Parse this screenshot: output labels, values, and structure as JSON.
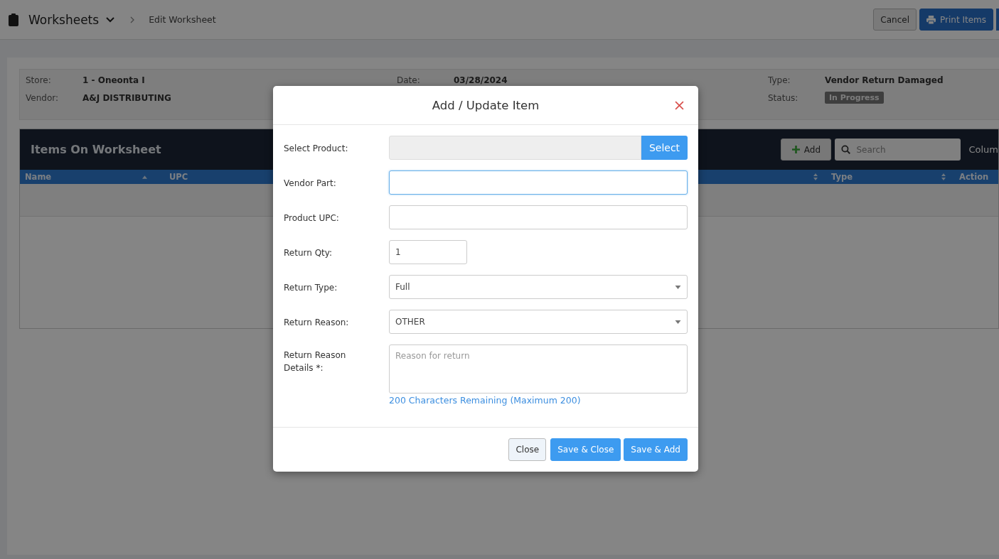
{
  "breadcrumb": {
    "title": "Worksheets",
    "current": "Edit Worksheet"
  },
  "header_buttons": [
    {
      "label": "Cancel",
      "kind": "secondary"
    },
    {
      "label": "Print Items",
      "kind": "primary"
    }
  ],
  "info_left": [
    {
      "label": "Store:",
      "value": "1 - Oneonta I"
    },
    {
      "label": "Vendor:",
      "value": "A&J DISTRIBUTING"
    }
  ],
  "info_middle": [
    {
      "label": "Date:",
      "value": "03/28/2024"
    }
  ],
  "info_right": [
    {
      "label": "Type:",
      "value": "Vendor Return Damaged",
      "kind": "text"
    },
    {
      "label": "Status:",
      "value": "In Progress",
      "kind": "badge"
    }
  ],
  "items_panel": {
    "title": "Items On Worksheet",
    "add_label": "Add",
    "search_placeholder": "Search",
    "columns_label": "Colum",
    "columns": [
      {
        "label": "Name",
        "sorted": true
      },
      {
        "label": "UPC",
        "sorted": false
      },
      {
        "label": "Type",
        "sorted": false
      },
      {
        "label": "Action"
      }
    ]
  },
  "modal": {
    "title": "Add / Update Item",
    "fields": [
      {
        "label": "Select Product:",
        "kind": "picker",
        "button": "Select"
      },
      {
        "label": "Vendor Part:",
        "kind": "text",
        "focused": true
      },
      {
        "label": "Product UPC:",
        "kind": "text",
        "focused": false
      },
      {
        "label": "Return Qty:",
        "kind": "qty",
        "value": "1"
      },
      {
        "label": "Return Type:",
        "kind": "select",
        "value": "Full"
      },
      {
        "label": "Return Reason:",
        "kind": "select",
        "value": "OTHER"
      },
      {
        "label": "Return Reason Details *:",
        "kind": "textarea",
        "placeholder": "Reason for return",
        "hint": "200 Characters Remaining (Maximum 200)"
      }
    ],
    "buttons": [
      {
        "label": "Close",
        "kind": "secondary"
      },
      {
        "label": "Save & Close",
        "kind": "primary"
      },
      {
        "label": "Save & Add",
        "kind": "primary"
      }
    ]
  }
}
